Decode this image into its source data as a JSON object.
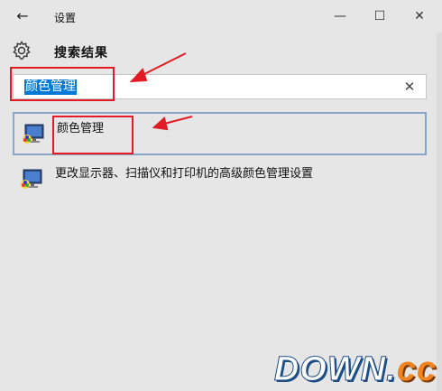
{
  "window": {
    "title": "设置",
    "back_icon": "arrow-left-icon",
    "minimize_glyph": "—",
    "maximize_glyph": "☐",
    "close_glyph": "✕"
  },
  "page": {
    "heading": "搜索结果",
    "heading_icon": "gear-icon"
  },
  "search": {
    "value": "颜色管理",
    "clear_glyph": "✕"
  },
  "results": [
    {
      "label": "颜色管理",
      "icon": "color-management-icon",
      "selected": true
    },
    {
      "label": "更改显示器、扫描仪和打印机的高级颜色管理设置",
      "icon": "color-management-icon",
      "selected": false
    }
  ],
  "annotations": {
    "color": "#e21b24"
  },
  "watermark": {
    "text_main": "DOWN.",
    "text_accent": "cc"
  },
  "colors": {
    "accent": "#0078d7",
    "window_bg": "#e6e6e6",
    "selection_border": "#8aa6c4"
  }
}
